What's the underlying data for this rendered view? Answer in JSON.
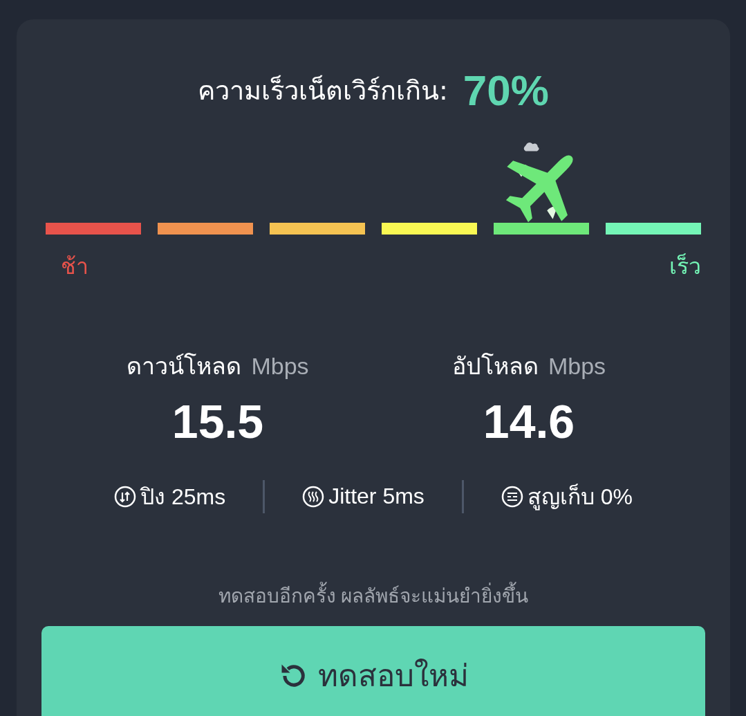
{
  "header": {
    "label": "ความเร็วเน็ตเวิร์กเกิน:",
    "percent": "70%"
  },
  "meter": {
    "segments": [
      {
        "color": "#e8534b",
        "selected": false
      },
      {
        "color": "#f0924f",
        "selected": false
      },
      {
        "color": "#f5c352",
        "selected": false
      },
      {
        "color": "#f9f853",
        "selected": false
      },
      {
        "color": "#6ee87a",
        "selected": true
      },
      {
        "color": "#74f5b6",
        "selected": false
      }
    ],
    "slow_label": "ช้า",
    "fast_label": "เร็ว"
  },
  "stats": [
    {
      "label": "ดาวน์โหลด",
      "unit": "Mbps",
      "value": "15.5"
    },
    {
      "label": "อัปโหลด",
      "unit": "Mbps",
      "value": "14.6"
    }
  ],
  "metrics": [
    {
      "kind": "ping",
      "text": "ปิง 25ms"
    },
    {
      "kind": "jitter",
      "text": "Jitter 5ms"
    },
    {
      "kind": "loss",
      "text": "สูญเก็บ 0%"
    }
  ],
  "hint": "ทดสอบอีกครั้ง ผลลัพธ์จะแม่นยำยิ่งขึ้น",
  "button": {
    "label": "ทดสอบใหม่"
  }
}
